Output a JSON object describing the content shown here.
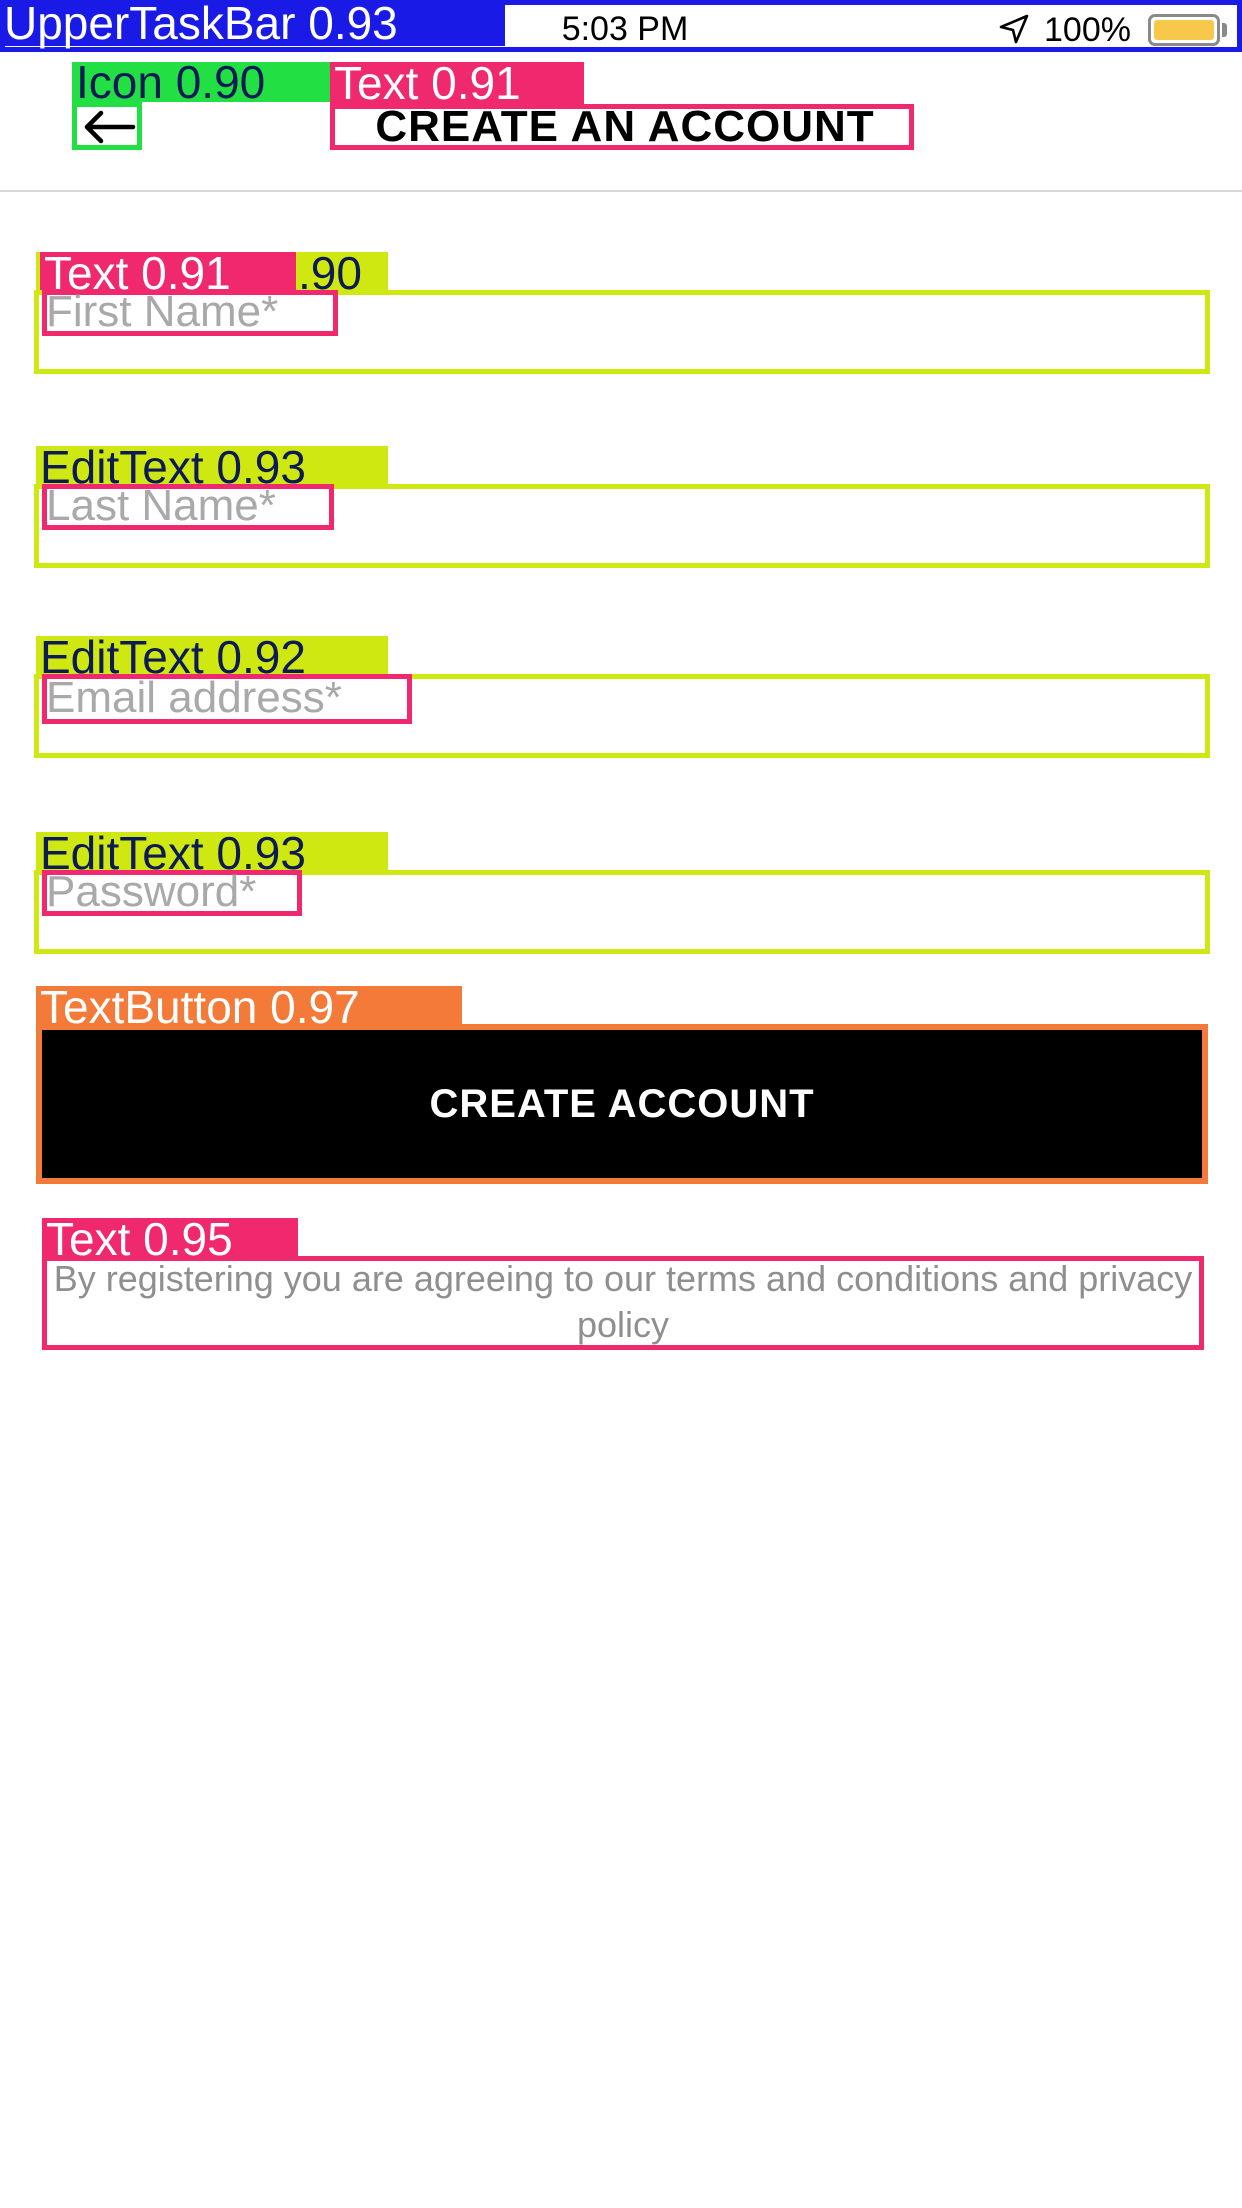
{
  "status_bar": {
    "carrier": "UpperTaskBar 0.93",
    "time": "5:03 PM",
    "battery_percent": "100%",
    "battery_level": 1.0,
    "icons": [
      "location-arrow-icon",
      "battery-icon"
    ]
  },
  "header": {
    "back_icon_tag": "Icon 0.90",
    "title_tag": "Text 0.91",
    "title": "CREATE AN ACCOUNT",
    "back_icon": "arrow-left-icon"
  },
  "form": {
    "fields": [
      {
        "tag": "Text 0.91",
        "tag_suffix": ".90",
        "placeholder": "First Name*"
      },
      {
        "tag": "EditText 0.93",
        "placeholder": "Last Name*"
      },
      {
        "tag": "EditText 0.92",
        "placeholder": "Email address*"
      },
      {
        "tag": "EditText 0.93",
        "placeholder": "Password*"
      }
    ]
  },
  "button": {
    "tag": "TextButton 0.97",
    "label": "CREATE ACCOUNT"
  },
  "terms": {
    "tag": "Text 0.95",
    "text": "By registering you are agreeing to our terms and conditions and privacy policy"
  },
  "colors": {
    "status_bar": "#1a1ae6",
    "icon_box": "#22e044",
    "text_box": "#f0286e",
    "edittext_box": "#cfe812",
    "button_box": "#f47a3a",
    "button_fill": "#000000",
    "placeholder": "#a9a9a9"
  }
}
